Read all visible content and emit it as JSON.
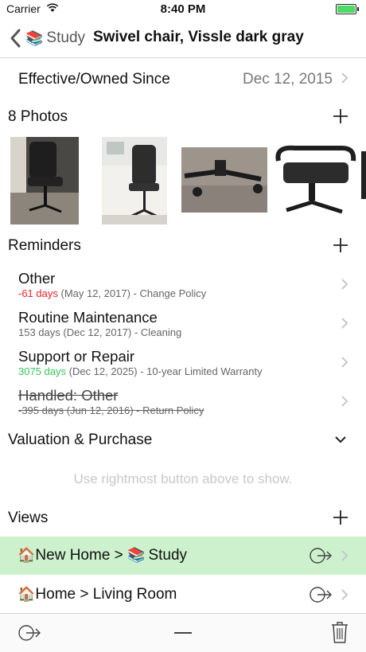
{
  "status": {
    "carrier": "Carrier",
    "time": "8:40 PM"
  },
  "nav": {
    "back_emoji": "📚",
    "back_label": "Study",
    "title": "Swivel chair, Vissle dark gray"
  },
  "effective": {
    "label": "Effective/Owned Since",
    "value": "Dec 12, 2015"
  },
  "photos": {
    "header": "8 Photos"
  },
  "reminders": {
    "header": "Reminders",
    "items": [
      {
        "title": "Other",
        "days": "-61 days",
        "detail": " (May 12, 2017) - Change Policy"
      },
      {
        "title": "Routine Maintenance",
        "days": "153 days",
        "detail": " (Dec 12, 2017) - Cleaning"
      },
      {
        "title": "Support or Repair",
        "days": "3075 days",
        "detail": " (Dec 12, 2025) - 10-year Limited Warranty"
      },
      {
        "title": "Handled: Other",
        "days": "-395 days",
        "detail": " (Jun 12, 2016) - Return Policy"
      }
    ]
  },
  "valuation": {
    "header": "Valuation & Purchase",
    "placeholder": "Use rightmost button above to show."
  },
  "views": {
    "header": "Views",
    "items": [
      {
        "emoji1": "🏠",
        "label": "New Home > ",
        "emoji2": "📚",
        "label2": "Study"
      },
      {
        "emoji1": "🏠",
        "label": "Home > Living Room"
      }
    ]
  },
  "colors": {
    "selected_row": "#ccf1cc",
    "negative_days": "#e8232a",
    "positive_days": "#35c759"
  }
}
